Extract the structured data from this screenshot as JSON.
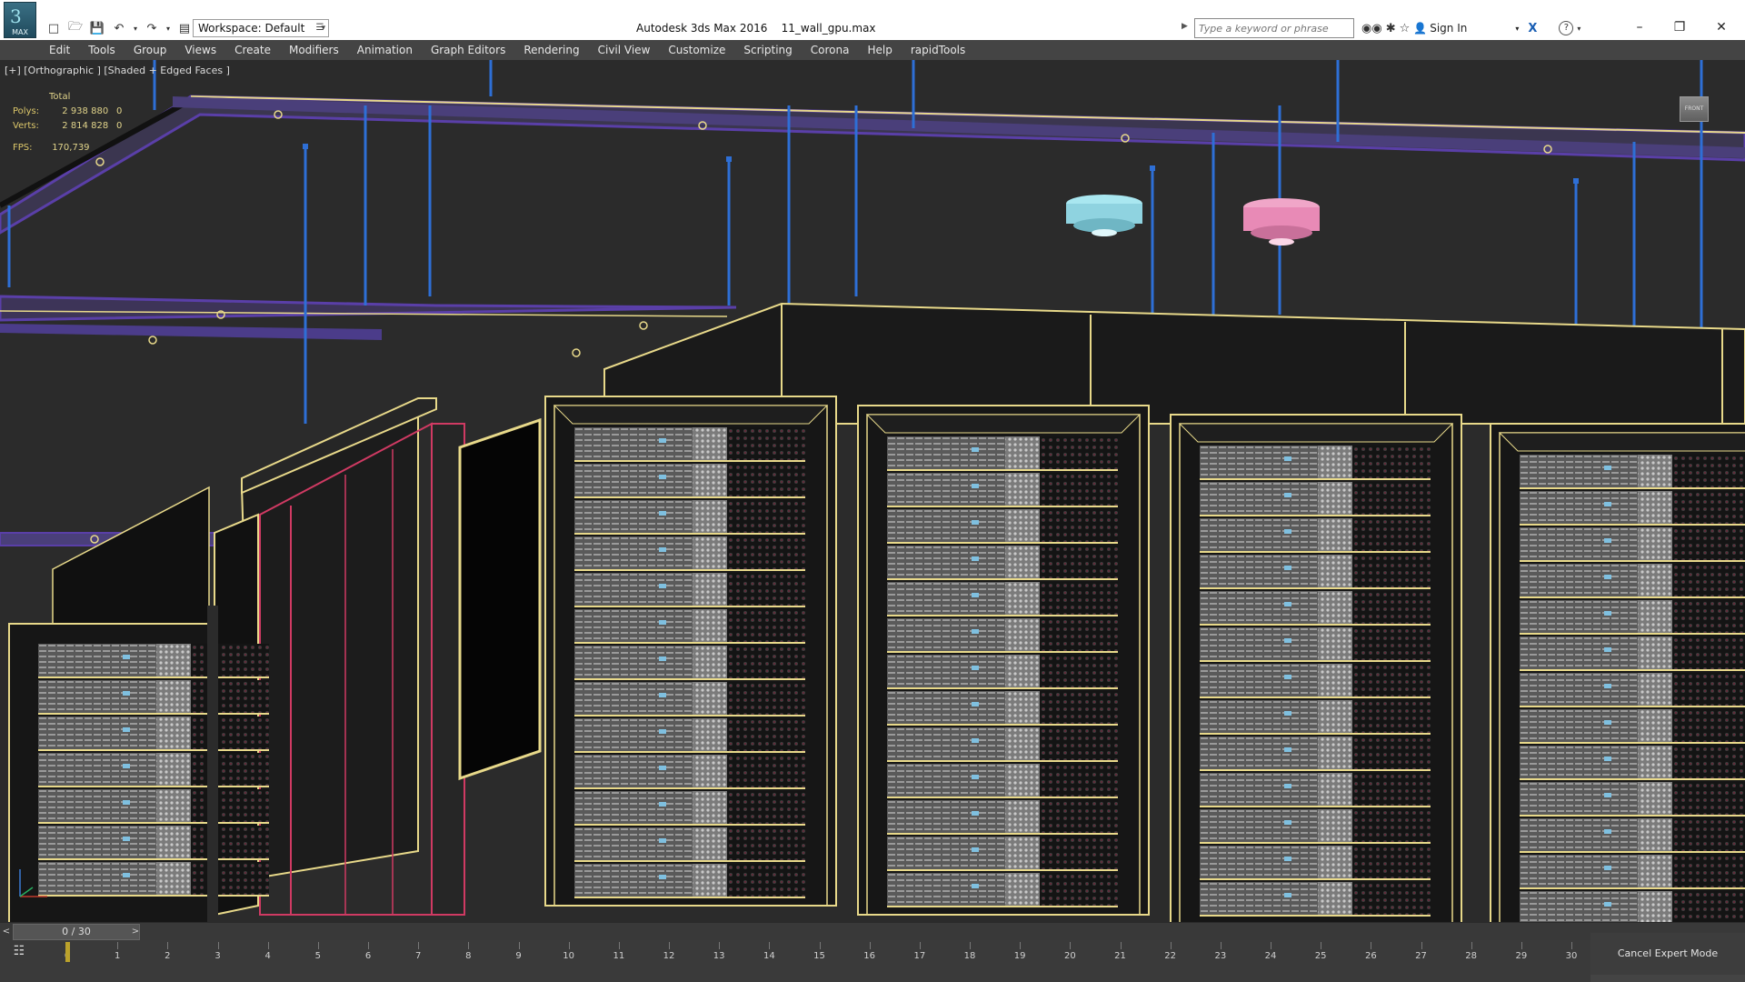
{
  "titlebar": {
    "app_logo_text": "MAX",
    "title": "Autodesk 3ds Max 2016    11_wall_gpu.max",
    "workspace": "Workspace: Default",
    "search_placeholder": "Type a keyword or phrase",
    "sign_in": "Sign In"
  },
  "menubar": {
    "items": [
      "Edit",
      "Tools",
      "Group",
      "Views",
      "Create",
      "Modifiers",
      "Animation",
      "Graph Editors",
      "Rendering",
      "Civil View",
      "Customize",
      "Scripting",
      "Corona",
      "Help",
      "rapidTools"
    ]
  },
  "viewport": {
    "label": "[+] [Orthographic ] [Shaded + Edged Faces ]",
    "stats": {
      "total_label": "Total",
      "polys_label": "Polys:",
      "polys_value": "2 938 880",
      "polys_selected": "0",
      "verts_label": "Verts:",
      "verts_value": "2 814 828",
      "verts_selected": "0",
      "fps_label": "FPS:",
      "fps_value": "170,739"
    },
    "viewcube_text": "FRONT",
    "colors": {
      "background": "#2b2b2b",
      "edge_yellow": "#e8d98a",
      "tray_purple": "#5a3fa8",
      "cable_blue": "#2e6fd6",
      "selection_red": "#d03a63",
      "detector_cyan": "#a9e7f0",
      "detector_pink": "#f0a6c8"
    }
  },
  "timeline": {
    "frame_display": "0 / 30",
    "current_frame": 0,
    "ticks": [
      "0",
      "1",
      "2",
      "3",
      "4",
      "5",
      "6",
      "7",
      "8",
      "9",
      "10",
      "11",
      "12",
      "13",
      "14",
      "15",
      "16",
      "17",
      "18",
      "19",
      "20",
      "21",
      "22",
      "23",
      "24",
      "25",
      "26",
      "27",
      "28",
      "29",
      "30"
    ]
  },
  "statusbar": {
    "expert_mode_button": "Cancel Expert Mode"
  }
}
